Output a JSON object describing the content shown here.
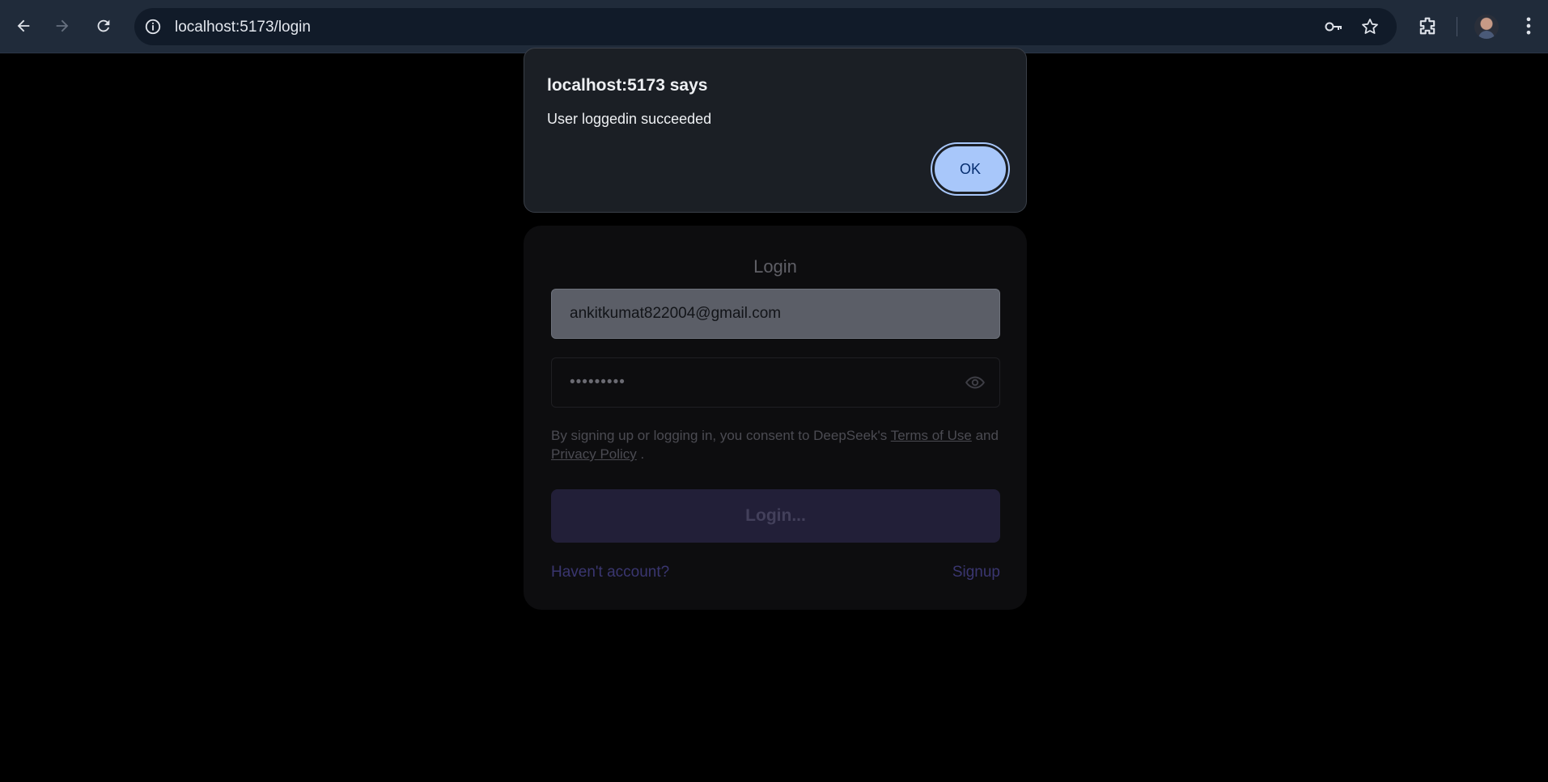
{
  "browser": {
    "url": "localhost:5173/login",
    "icons": [
      "back-arrow-icon",
      "forward-arrow-icon",
      "reload-icon",
      "site-info-icon",
      "password-key-icon",
      "bookmark-star-icon",
      "extensions-icon",
      "profile-avatar",
      "more-menu-icon"
    ]
  },
  "dialog": {
    "title": "localhost:5173 says",
    "message": "User loggedin succeeded",
    "ok_label": "OK"
  },
  "login": {
    "title": "Login",
    "email_value": "ankitkumat822004@gmail.com",
    "password_value": "•••••••••",
    "consent_prefix": "By signing up or logging in, you consent to DeepSeek's",
    "terms_label": "Terms of Use",
    "consent_and": "and",
    "privacy_label": "Privacy Policy",
    "consent_suffix": ".",
    "button_label": "Login...",
    "no_account_label": "Haven't account?",
    "signup_label": "Signup"
  },
  "colors": {
    "page_background": "#000000",
    "toolbar": "#202b3a",
    "dialog_ok": "#a8c7fa",
    "login_button": "#221f38",
    "link": "#3a3670"
  }
}
